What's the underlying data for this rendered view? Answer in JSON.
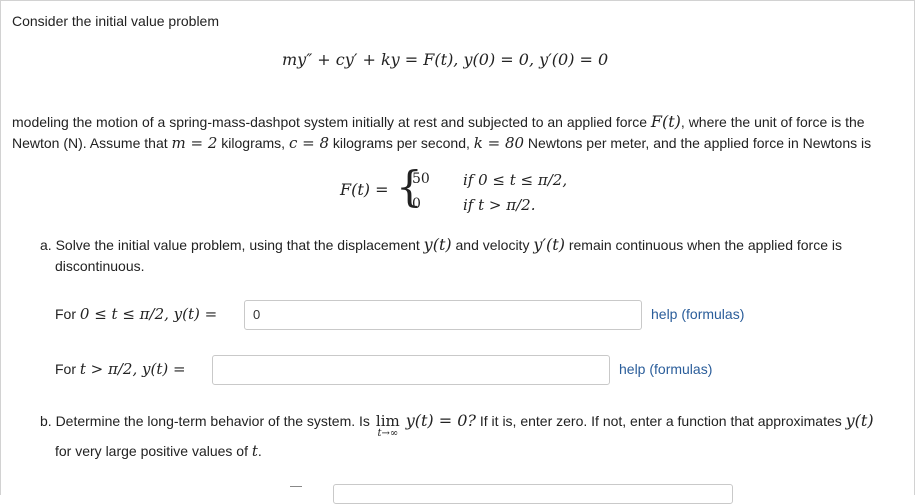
{
  "intro": "Consider the initial value problem",
  "ivp_equation": "my″ + cy′ + ky = F(t),   y(0) = 0,   y′(0) = 0",
  "paragraph": {
    "line1_a": "modeling the motion of a spring-mass-dashpot system initially at rest and subjected to an applied force ",
    "line1_var": "F(t)",
    "line1_b": ", where the unit of force is the",
    "line2_a": "Newton (N). Assume that ",
    "m_eq": "m = 2",
    "line2_b": " kilograms, ",
    "c_eq": "c = 8",
    "line2_c": " kilograms per second, ",
    "k_eq": "k = 80",
    "line2_d": " Newtons per meter, and the applied force in Newtons is"
  },
  "piecewise": {
    "lhs": "F(t) =",
    "case1_value": "50",
    "case1_cond": "if 0 ≤ t ≤ π/2,",
    "case2_value": "0",
    "case2_cond": "if t > π/2."
  },
  "part_a": {
    "line1_a": "a. Solve the initial value problem, using that the displacement ",
    "y_var": "y(t)",
    "line1_b": " and velocity ",
    "yp_var": "y′(t)",
    "line1_c": " remain continuous when the applied force is",
    "line2": "discontinuous.",
    "row1_label_prefix": "For ",
    "row1_condition": "0 ≤ t ≤ π/2,  y(t) =",
    "row1_value": "0",
    "row1_help": "help (formulas)",
    "row2_label_prefix": "For ",
    "row2_condition": "t > π/2,  y(t) =",
    "row2_value": "",
    "row2_help": "help (formulas)"
  },
  "part_b": {
    "line1_a": "b. Determine the long-term behavior of the system. Is ",
    "lim": "lim",
    "lim_sub": "t→∞",
    "lim_expr": "y(t) = 0?",
    "line1_b": " If it is, enter zero. If not, enter a function that approximates ",
    "y_var": "y(t)",
    "line2_a": "for very large positive values of ",
    "t_var": "t",
    "line2_b": "."
  },
  "colors": {
    "link": "#2a5d9a",
    "border": "#c9c9c9"
  }
}
